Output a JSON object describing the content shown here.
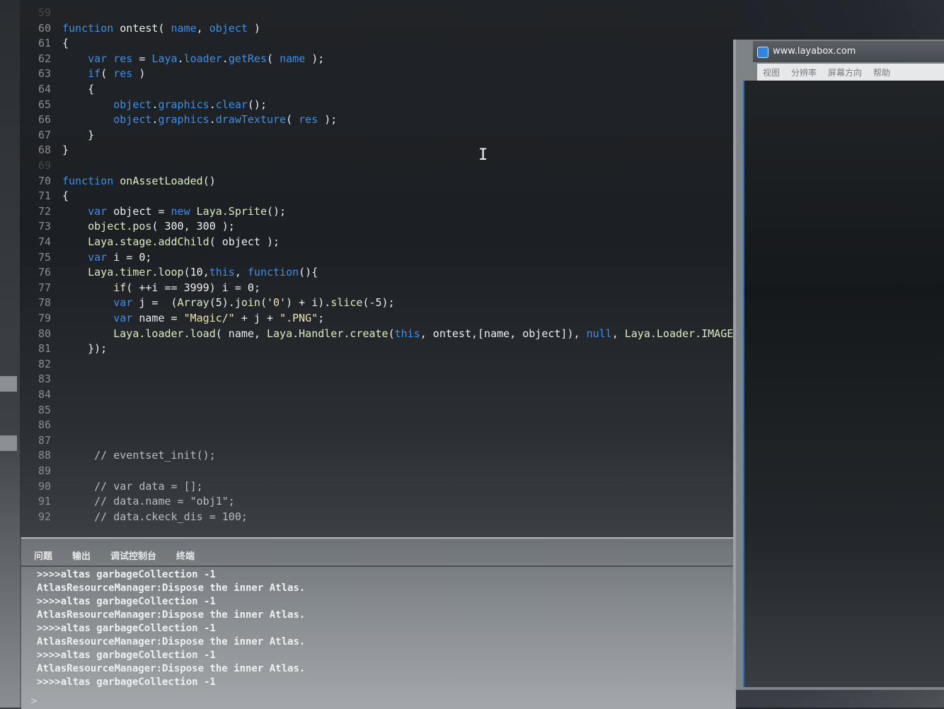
{
  "editor": {
    "lines": [
      {
        "n": "59",
        "dim": true,
        "parts": []
      },
      {
        "n": "60",
        "dim": false,
        "parts": [
          [
            "kw",
            "function"
          ],
          [
            "id",
            " ontest( "
          ],
          [
            "kw",
            "name"
          ],
          [
            "id",
            ", "
          ],
          [
            "kw",
            "object"
          ],
          [
            "id",
            " )"
          ]
        ]
      },
      {
        "n": "61",
        "dim": false,
        "parts": [
          [
            "id",
            "{"
          ]
        ]
      },
      {
        "n": "62",
        "dim": false,
        "parts": [
          [
            "id",
            "    "
          ],
          [
            "kw",
            "var"
          ],
          [
            "id",
            " "
          ],
          [
            "kw",
            "res"
          ],
          [
            "id",
            " = "
          ],
          [
            "kw",
            "Laya"
          ],
          [
            "id",
            "."
          ],
          [
            "kw",
            "loader"
          ],
          [
            "id",
            "."
          ],
          [
            "kw",
            "getRes"
          ],
          [
            "id",
            "( "
          ],
          [
            "kw",
            "name"
          ],
          [
            "id",
            " );"
          ]
        ]
      },
      {
        "n": "63",
        "dim": false,
        "parts": [
          [
            "id",
            "    "
          ],
          [
            "kw",
            "if"
          ],
          [
            "id",
            "( "
          ],
          [
            "kw",
            "res"
          ],
          [
            "id",
            " )"
          ]
        ]
      },
      {
        "n": "64",
        "dim": false,
        "parts": [
          [
            "id",
            "    {"
          ]
        ]
      },
      {
        "n": "65",
        "dim": false,
        "parts": [
          [
            "id",
            "        "
          ],
          [
            "kw",
            "object"
          ],
          [
            "id",
            "."
          ],
          [
            "kw",
            "graphics"
          ],
          [
            "id",
            "."
          ],
          [
            "kw",
            "clear"
          ],
          [
            "id",
            "();"
          ]
        ]
      },
      {
        "n": "66",
        "dim": false,
        "parts": [
          [
            "id",
            "        "
          ],
          [
            "kw",
            "object"
          ],
          [
            "id",
            "."
          ],
          [
            "kw",
            "graphics"
          ],
          [
            "id",
            "."
          ],
          [
            "kw",
            "drawTexture"
          ],
          [
            "id",
            "( "
          ],
          [
            "kw",
            "res"
          ],
          [
            "id",
            " );"
          ]
        ]
      },
      {
        "n": "67",
        "dim": false,
        "parts": [
          [
            "id",
            "    }"
          ]
        ]
      },
      {
        "n": "68",
        "dim": false,
        "parts": [
          [
            "id",
            "}"
          ]
        ]
      },
      {
        "n": "69",
        "dim": true,
        "parts": []
      },
      {
        "n": "70",
        "dim": false,
        "parts": [
          [
            "kw",
            "function"
          ],
          [
            "id",
            " "
          ],
          [
            "fn",
            "onAssetLoaded"
          ],
          [
            "id",
            "()"
          ]
        ]
      },
      {
        "n": "71",
        "dim": false,
        "parts": [
          [
            "id",
            "{"
          ]
        ]
      },
      {
        "n": "72",
        "dim": false,
        "parts": [
          [
            "id",
            "    "
          ],
          [
            "kw",
            "var"
          ],
          [
            "id",
            " object = "
          ],
          [
            "kw",
            "new"
          ],
          [
            "id",
            " "
          ],
          [
            "fn",
            "Laya.Sprite"
          ],
          [
            "id",
            "();"
          ]
        ]
      },
      {
        "n": "73",
        "dim": false,
        "parts": [
          [
            "id",
            "    "
          ],
          [
            "fn",
            "object.pos"
          ],
          [
            "id",
            "( "
          ],
          [
            "num",
            "300"
          ],
          [
            "id",
            ", "
          ],
          [
            "num",
            "300"
          ],
          [
            "id",
            " );"
          ]
        ]
      },
      {
        "n": "74",
        "dim": false,
        "parts": [
          [
            "id",
            "    "
          ],
          [
            "fn",
            "Laya.stage.addChild"
          ],
          [
            "id",
            "( object );"
          ]
        ]
      },
      {
        "n": "75",
        "dim": false,
        "parts": [
          [
            "id",
            "    "
          ],
          [
            "kw",
            "var"
          ],
          [
            "id",
            " i = "
          ],
          [
            "num",
            "0"
          ],
          [
            "id",
            ";"
          ]
        ]
      },
      {
        "n": "76",
        "dim": false,
        "parts": [
          [
            "id",
            "    "
          ],
          [
            "fn",
            "Laya.timer.loop"
          ],
          [
            "id",
            "("
          ],
          [
            "num",
            "10"
          ],
          [
            "id",
            ","
          ],
          [
            "kw",
            "this"
          ],
          [
            "id",
            ", "
          ],
          [
            "kw",
            "function"
          ],
          [
            "id",
            "(){"
          ]
        ]
      },
      {
        "n": "77",
        "dim": false,
        "parts": [
          [
            "id",
            "        "
          ],
          [
            "str",
            "if"
          ],
          [
            "id",
            "( ++i == "
          ],
          [
            "num",
            "3999"
          ],
          [
            "id",
            ") i = "
          ],
          [
            "num",
            "0"
          ],
          [
            "id",
            ";"
          ]
        ]
      },
      {
        "n": "78",
        "dim": false,
        "parts": [
          [
            "id",
            "        "
          ],
          [
            "kw",
            "var"
          ],
          [
            "id",
            " j =  ("
          ],
          [
            "fn",
            "Array"
          ],
          [
            "id",
            "("
          ],
          [
            "num",
            "5"
          ],
          [
            "id",
            ")."
          ],
          [
            "fn",
            "join"
          ],
          [
            "id",
            "("
          ],
          [
            "str",
            "'0'"
          ],
          [
            "id",
            ") + i)."
          ],
          [
            "fn",
            "slice"
          ],
          [
            "id",
            "(-5);"
          ]
        ]
      },
      {
        "n": "79",
        "dim": false,
        "parts": [
          [
            "id",
            "        "
          ],
          [
            "kw",
            "var"
          ],
          [
            "id",
            " name = "
          ],
          [
            "str",
            "\"Magic/\""
          ],
          [
            "id",
            " + j + "
          ],
          [
            "str",
            "\".PNG\""
          ],
          [
            "id",
            ";"
          ]
        ]
      },
      {
        "n": "80",
        "dim": false,
        "parts": [
          [
            "id",
            "        "
          ],
          [
            "fn",
            "Laya.loader.load"
          ],
          [
            "id",
            "( name, "
          ],
          [
            "fn",
            "Laya.Handler.create"
          ],
          [
            "id",
            "("
          ],
          [
            "kw",
            "this"
          ],
          [
            "id",
            ", ontest,[name, object]), "
          ],
          [
            "kw",
            "null"
          ],
          [
            "id",
            ", "
          ],
          [
            "fn",
            "Laya.Loader.IMAGE"
          ],
          [
            "id",
            ");"
          ]
        ]
      },
      {
        "n": "81",
        "dim": false,
        "parts": [
          [
            "id",
            "    });"
          ]
        ]
      },
      {
        "n": "82",
        "dim": false,
        "parts": []
      },
      {
        "n": "83",
        "dim": false,
        "parts": []
      },
      {
        "n": "84",
        "dim": false,
        "parts": []
      },
      {
        "n": "85",
        "dim": false,
        "parts": []
      },
      {
        "n": "86",
        "dim": false,
        "parts": []
      },
      {
        "n": "87",
        "dim": false,
        "parts": []
      },
      {
        "n": "88",
        "dim": false,
        "parts": [
          [
            "cm",
            "     // eventset_init();"
          ]
        ]
      },
      {
        "n": "89",
        "dim": false,
        "parts": []
      },
      {
        "n": "90",
        "dim": false,
        "parts": [
          [
            "cm",
            "     // var data = [];"
          ]
        ]
      },
      {
        "n": "91",
        "dim": false,
        "parts": [
          [
            "cm",
            "     // data.name = \"obj1\";"
          ]
        ]
      },
      {
        "n": "92",
        "dim": false,
        "parts": [
          [
            "cm",
            "     // data.ckeck_dis = 100;"
          ]
        ]
      }
    ]
  },
  "panel": {
    "tabs": [
      "问题",
      "输出",
      "调试控制台",
      "终端"
    ],
    "console_lines": [
      ">>>>altas garbageCollection -1",
      "AtlasResourceManager:Dispose the inner Atlas.",
      ">>>>altas garbageCollection -1",
      "AtlasResourceManager:Dispose the inner Atlas.",
      ">>>>altas garbageCollection -1",
      "AtlasResourceManager:Dispose the inner Atlas.",
      ">>>>altas garbageCollection -1",
      "AtlasResourceManager:Dispose the inner Atlas.",
      ">>>>altas garbageCollection -1"
    ],
    "prompt": ">"
  },
  "preview": {
    "title": "www.layabox.com",
    "menu": [
      "视图",
      "分辨率",
      "屏幕方向",
      "帮助"
    ]
  },
  "cursor_glyph": "I"
}
